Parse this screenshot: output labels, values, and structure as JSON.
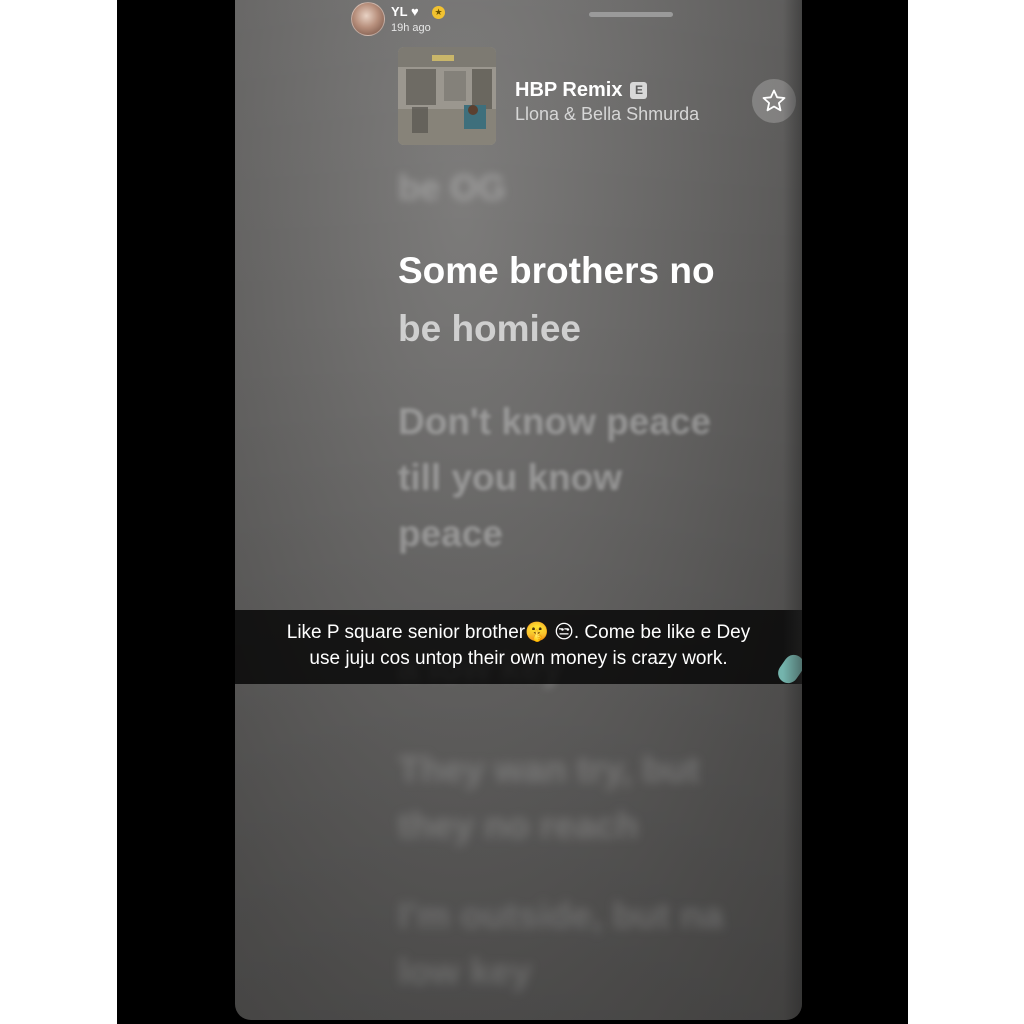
{
  "story": {
    "user_name": "YL",
    "time_ago": "19h ago",
    "icons": [
      "heart-icon",
      "star-badge-icon",
      "bell-icon",
      "more-vertical-icon"
    ]
  },
  "now_playing": {
    "title": "HBP Remix",
    "explicit_label": "E",
    "artist": "Llona & Bella Shmurda",
    "favorite_icon": "star-outline-icon",
    "more_icon": "ellipsis-icon"
  },
  "lyrics": {
    "previous": "be OG",
    "active_line_1": "Some brothers no",
    "active_line_2": "be homiee",
    "next_1": [
      "Don't know peace",
      "till you know",
      "peace"
    ],
    "hidden_partial": "a low key",
    "next_3": [
      "They wan try, but",
      "they no reach"
    ],
    "next_4": [
      "I'm outside, but na",
      "low key"
    ]
  },
  "caption": {
    "line_1": "Like P square senior brother",
    "emoji_1": "🤫",
    "emoji_2": "😒",
    "line_1_end": ".   Come be like e Dey",
    "line_2": "use juju cos untop their own money is crazy work."
  },
  "colors": {
    "background": "#ffffff",
    "frame": "#000000",
    "story_bg": "#6a6968",
    "badge_gold": "#f2c230",
    "drawing_mark": "#7fc7bf"
  }
}
